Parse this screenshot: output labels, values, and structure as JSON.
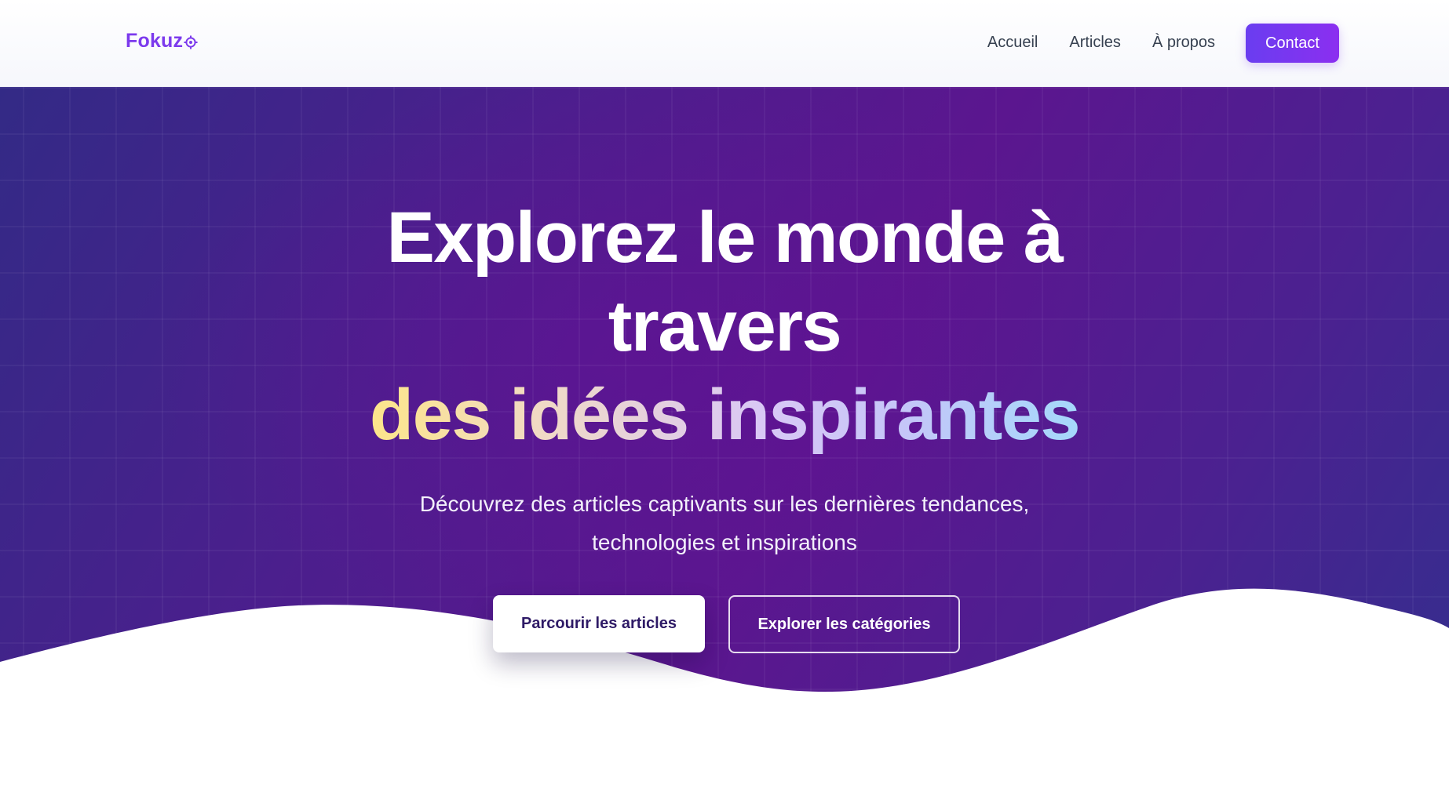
{
  "brand": {
    "name": "Fokuz",
    "icon": "target-icon",
    "color": "#7c3aed"
  },
  "nav": {
    "items": [
      {
        "label": "Accueil"
      },
      {
        "label": "Articles"
      },
      {
        "label": "À propos"
      }
    ],
    "contact_label": "Contact"
  },
  "hero": {
    "title_line1": "Explorez le monde à",
    "title_line2": "travers",
    "title_highlight": "des idées inspirantes",
    "subtitle_line1": "Découvrez des articles captivants sur les dernières tendances,",
    "subtitle_line2": "technologies et inspirations",
    "primary_button": "Parcourir les articles",
    "secondary_button": "Explorer les catégories"
  },
  "colors": {
    "accent": "#7c3aed",
    "hero_start": "#332a86",
    "hero_mid": "#5b168f",
    "highlight_start": "#fde68a",
    "highlight_end": "#a5d8fb"
  }
}
